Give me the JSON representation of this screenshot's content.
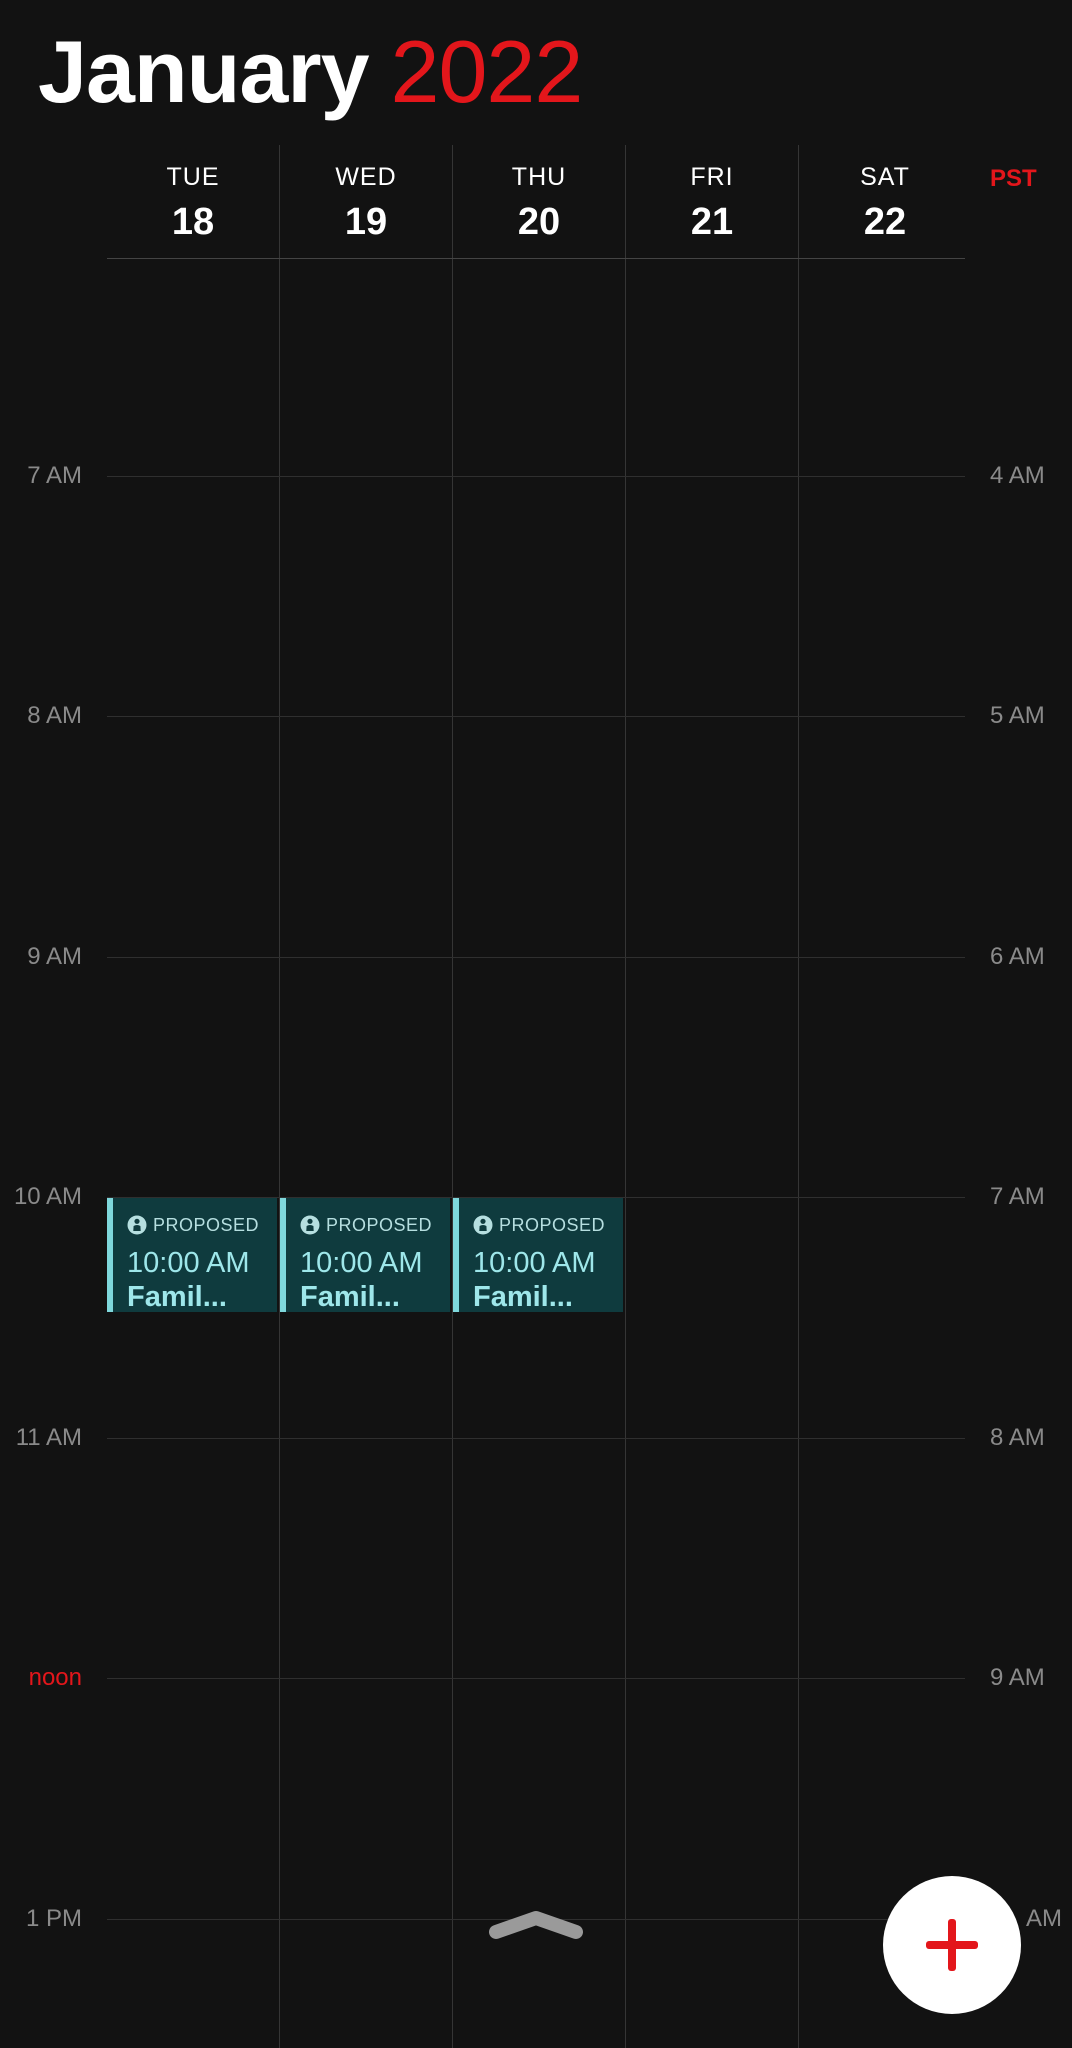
{
  "header": {
    "month": "January",
    "year": "2022"
  },
  "timezone_label": "PST",
  "days": [
    {
      "dow": "TUE",
      "date": "18"
    },
    {
      "dow": "WED",
      "date": "19"
    },
    {
      "dow": "THU",
      "date": "20"
    },
    {
      "dow": "FRI",
      "date": "21"
    },
    {
      "dow": "SAT",
      "date": "22"
    }
  ],
  "time_rows": [
    {
      "left": "7 AM",
      "right": "4 AM"
    },
    {
      "left": "8 AM",
      "right": "5 AM"
    },
    {
      "left": "9 AM",
      "right": "6 AM"
    },
    {
      "left": "10 AM",
      "right": "7 AM"
    },
    {
      "left": "11 AM",
      "right": "8 AM"
    },
    {
      "left": "noon",
      "right": "9 AM"
    },
    {
      "left": "1 PM",
      "right": "AM"
    }
  ],
  "events": [
    {
      "status": "PROPOSED",
      "time": "10:00 AM",
      "title": "Famil..."
    },
    {
      "status": "PROPOSED",
      "time": "10:00 AM",
      "title": "Famil..."
    },
    {
      "status": "PROPOSED",
      "time": "10:00 AM",
      "title": "Famil..."
    }
  ],
  "colors": {
    "accent_red": "#e3161b",
    "background": "#121212",
    "event_bg": "#0f3b3e",
    "event_bar": "#7fd8dc",
    "event_text": "#9ee7ea"
  },
  "icons": {
    "event_status": "person-circle-icon",
    "expand": "chevron-up-icon",
    "add": "plus-icon"
  }
}
